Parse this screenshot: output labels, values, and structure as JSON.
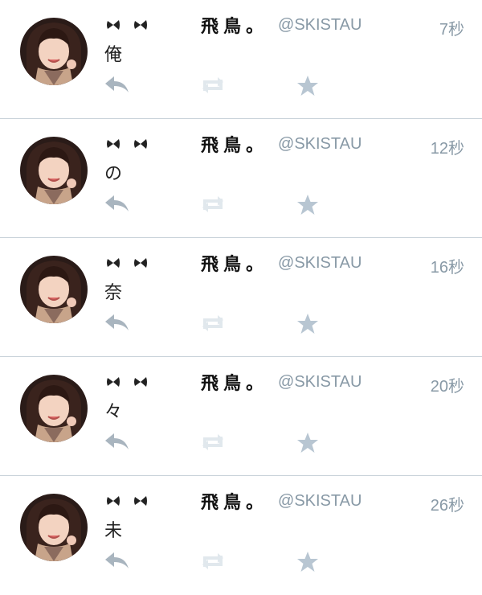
{
  "tweets": [
    {
      "name": "飛鳥。",
      "handle": "@SKISTAU",
      "time": "7秒",
      "text": "俺"
    },
    {
      "name": "飛鳥。",
      "handle": "@SKISTAU",
      "time": "12秒",
      "text": "の"
    },
    {
      "name": "飛鳥。",
      "handle": "@SKISTAU",
      "time": "16秒",
      "text": "奈"
    },
    {
      "name": "飛鳥。",
      "handle": "@SKISTAU",
      "time": "20秒",
      "text": "々"
    },
    {
      "name": "飛鳥。",
      "handle": "@SKISTAU",
      "time": "26秒",
      "text": "未"
    }
  ],
  "icons": {
    "name_prefix": [
      "heart-icon",
      "heart-icon"
    ],
    "actions": [
      "reply-icon",
      "retweet-icon",
      "favorite-star-icon"
    ]
  },
  "colors": {
    "meta_gray": "#8899a6",
    "icon_light": "#e1e8ed",
    "reply_gray": "#a9b5bf",
    "star_blue_gray": "#b8c6d2",
    "divider": "#c9d2da"
  }
}
